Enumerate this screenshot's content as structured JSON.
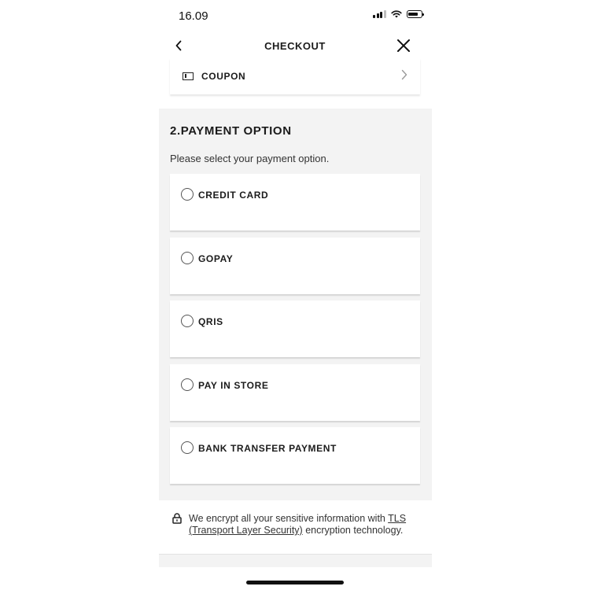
{
  "status_bar": {
    "time": "16.09"
  },
  "header": {
    "title": "CHECKOUT"
  },
  "coupon": {
    "label": "COUPON"
  },
  "payment": {
    "title": "2.PAYMENT OPTION",
    "subtitle": "Please select your payment option.",
    "options": [
      {
        "label": "CREDIT CARD"
      },
      {
        "label": "GOPAY"
      },
      {
        "label": "QRIS"
      },
      {
        "label": "PAY IN STORE"
      },
      {
        "label": "BANK TRANSFER PAYMENT"
      }
    ]
  },
  "security_note": {
    "prefix": "We encrypt all your sensitive information with ",
    "link1": "TLS",
    "link2": "(Transport Layer Security)",
    "suffix": " encryption technology."
  }
}
